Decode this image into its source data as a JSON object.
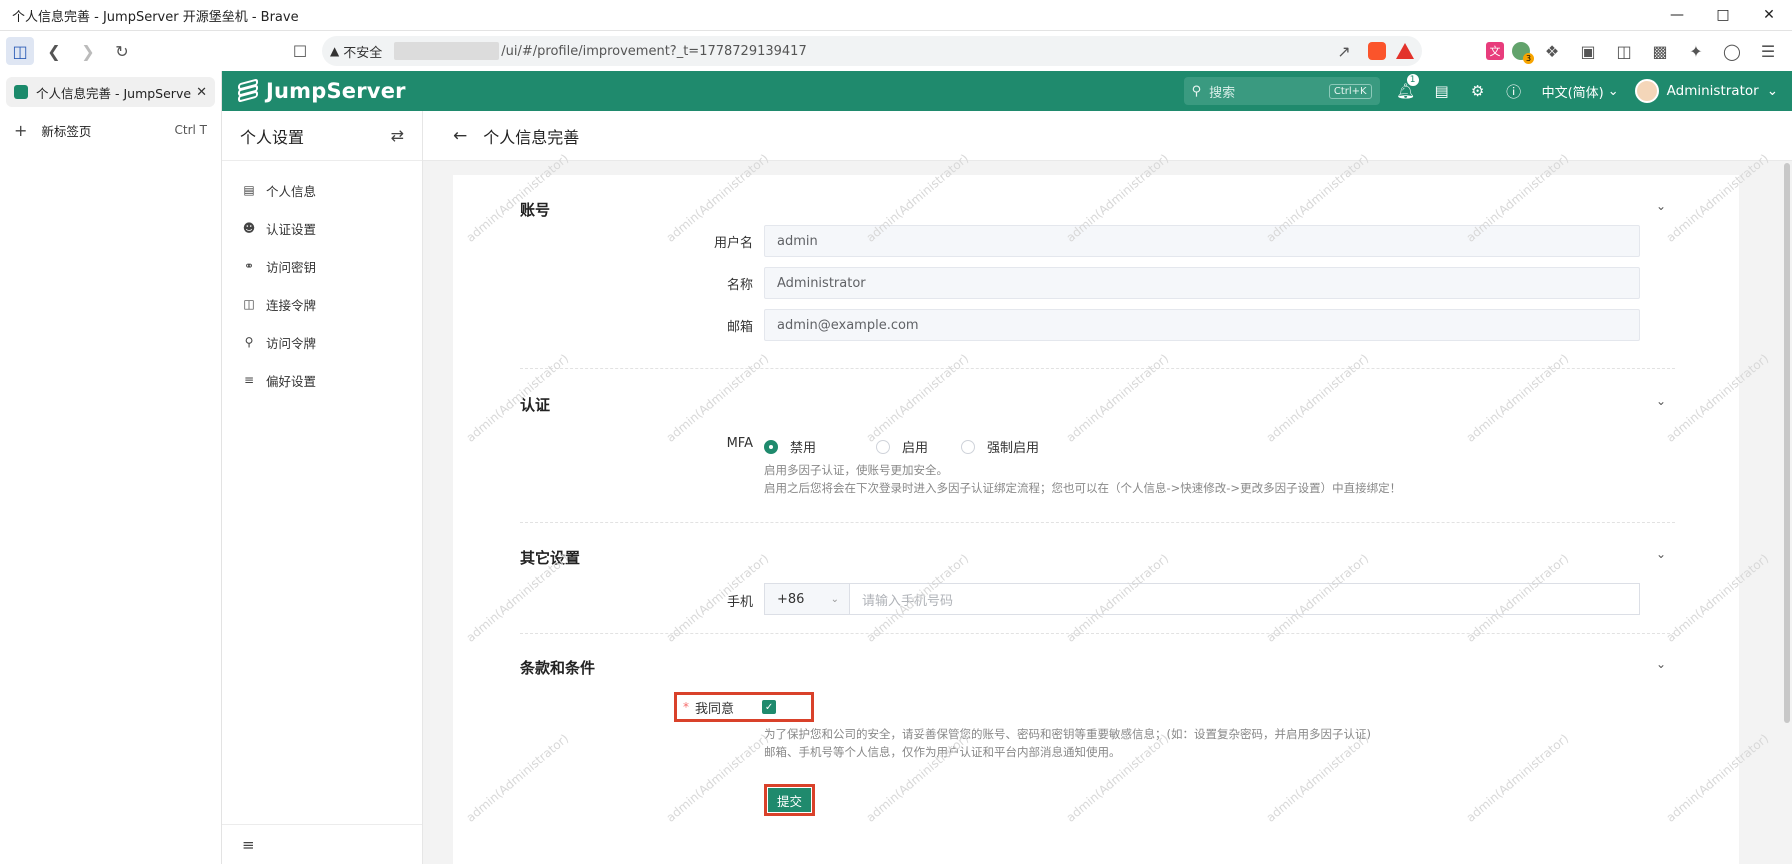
{
  "window": {
    "title": "个人信息完善 - JumpServer 开源堡垒机 - Brave"
  },
  "browser": {
    "insecure_label": "不安全",
    "url": "/ui/#/profile/improvement?_t=1778729139417",
    "tabs": [
      {
        "label": "个人信息完善 - JumpServe",
        "active": true
      }
    ],
    "new_tab_label": "新标签页",
    "new_tab_shortcut": "Ctrl  T"
  },
  "app": {
    "brand": "JumpServer",
    "search_placeholder": "搜索",
    "search_shortcut": "Ctrl+K",
    "notifications_count": "1",
    "language": "中文(简体)",
    "user": "Administrator",
    "accent_color": "#1f8a6d"
  },
  "sidebar": {
    "title": "个人设置",
    "items": [
      {
        "label": "个人信息",
        "icon": "id-card-icon"
      },
      {
        "label": "认证设置",
        "icon": "user-auth-icon"
      },
      {
        "label": "访问密钥",
        "icon": "key-icon"
      },
      {
        "label": "连接令牌",
        "icon": "shield-icon"
      },
      {
        "label": "访问令牌",
        "icon": "key-solid-icon"
      },
      {
        "label": "偏好设置",
        "icon": "sliders-icon"
      }
    ]
  },
  "page": {
    "title": "个人信息完善"
  },
  "account": {
    "section_title": "账号",
    "username_label": "用户名",
    "username_value": "admin",
    "name_label": "名称",
    "name_value": "Administrator",
    "email_label": "邮箱",
    "email_value": "admin@example.com"
  },
  "auth": {
    "section_title": "认证",
    "mfa_label": "MFA",
    "options": [
      "禁用",
      "启用",
      "强制启用"
    ],
    "selected": "禁用",
    "help_line1": "启用多因子认证，使账号更加安全。",
    "help_line2": "启用之后您将会在下次登录时进入多因子认证绑定流程；您也可以在（个人信息->快速修改->更改多因子设置）中直接绑定！"
  },
  "other": {
    "section_title": "其它设置",
    "phone_label": "手机",
    "phone_code": "+86",
    "phone_placeholder": "请输入手机号码"
  },
  "terms": {
    "section_title": "条款和条件",
    "required_mark": "*",
    "agree_label": "我同意",
    "agree_checked": true,
    "help_line1": "为了保护您和公司的安全，请妥善保管您的账号、密码和密钥等重要敏感信息；(如：设置复杂密码，并启用多因子认证)",
    "help_line2": "邮箱、手机号等个人信息，仅作为用户认证和平台内部消息通知使用。"
  },
  "submit_label": "提交",
  "watermark_text": "admin(Administrator)"
}
